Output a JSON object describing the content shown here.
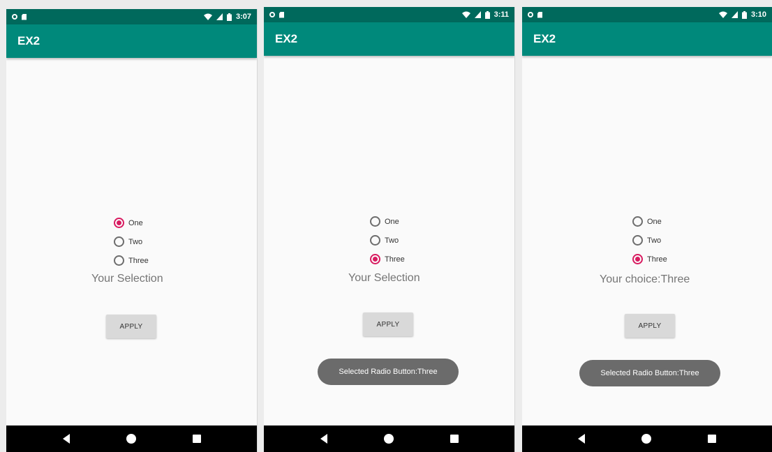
{
  "screens": [
    {
      "status_time": "3:07",
      "app_title": "EX2",
      "radios": [
        {
          "label": "One",
          "checked": true
        },
        {
          "label": "Two",
          "checked": false
        },
        {
          "label": "Three",
          "checked": false
        }
      ],
      "selection_text": "Your Selection",
      "apply_label": "APPLY",
      "toast": null
    },
    {
      "status_time": "3:11",
      "app_title": "EX2",
      "radios": [
        {
          "label": "One",
          "checked": false
        },
        {
          "label": "Two",
          "checked": false
        },
        {
          "label": "Three",
          "checked": true
        }
      ],
      "selection_text": "Your Selection",
      "apply_label": "APPLY",
      "toast": "Selected Radio Button:Three"
    },
    {
      "status_time": "3:10",
      "app_title": "EX2",
      "radios": [
        {
          "label": "One",
          "checked": false
        },
        {
          "label": "Two",
          "checked": false
        },
        {
          "label": "Three",
          "checked": true
        }
      ],
      "selection_text": "Your choice:Three",
      "apply_label": "APPLY",
      "toast": "Selected Radio Button:Three"
    }
  ],
  "icons": {
    "status_left": [
      "circle-notification-icon",
      "sd-card-icon"
    ],
    "status_right": [
      "wifi-icon",
      "signal-icon",
      "battery-icon"
    ],
    "nav": [
      "back-icon",
      "home-icon",
      "recents-icon"
    ]
  },
  "colors": {
    "status_bar": "#00695c",
    "app_bar": "#00897b",
    "accent": "#d81b60",
    "toast": "#6b6b6b",
    "nav_bar": "#000000"
  }
}
